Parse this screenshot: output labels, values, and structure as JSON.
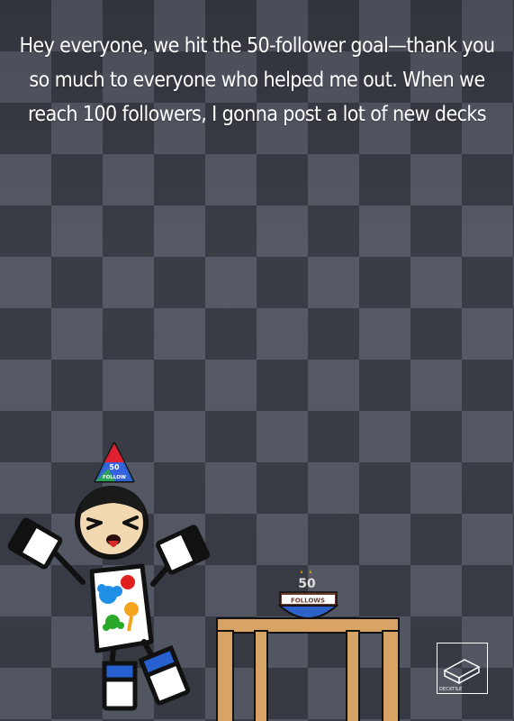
{
  "caption": "Hey everyone, we hit the 50-follower goal—thank you so much to everyone who helped me out. When we reach 100 followers, I gonna post a lot of new decks",
  "party_hat": {
    "number": "50",
    "word": "FOLLOW"
  },
  "cake": {
    "candle_number": "50",
    "label": "FOLLOWS"
  },
  "logo_text": "DECKTILE",
  "colors": {
    "background_dark": "#3a3d46",
    "background_light": "#565a66",
    "table": "#d7a465",
    "bowl": "#2f62c9",
    "bowl_band": "#6b3b2f",
    "outline": "#111111"
  }
}
